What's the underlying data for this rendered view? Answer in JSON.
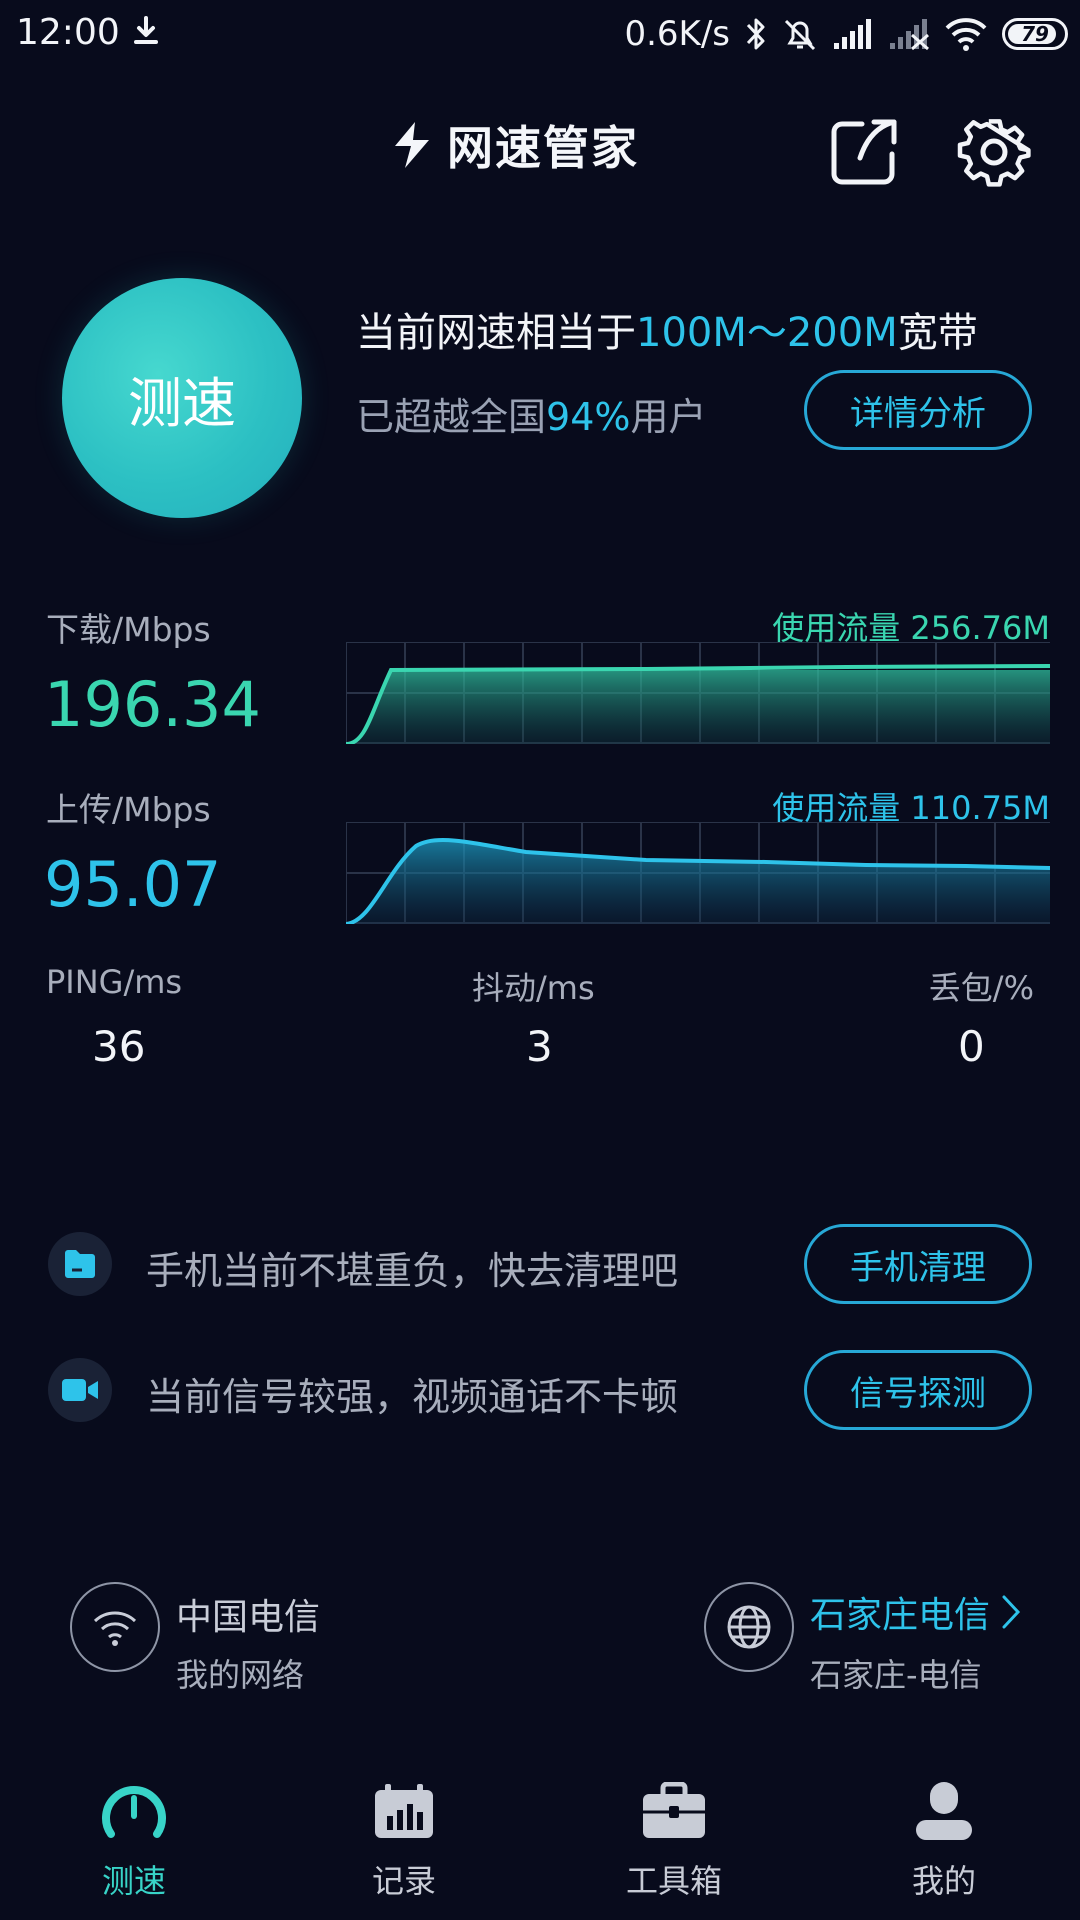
{
  "status_bar": {
    "time": "12:00",
    "net_speed": "0.6K/s",
    "battery": "79"
  },
  "header": {
    "app_title": "网速管家",
    "share_icon": "share-icon",
    "settings_icon": "gear-icon"
  },
  "hero": {
    "test_button": "测速",
    "equiv_prefix": "当前网速相当于",
    "equiv_range": "100M～200M",
    "equiv_suffix": "宽带",
    "beat_prefix": "已超越全国",
    "beat_percent": "94%",
    "beat_suffix": "用户",
    "detail_button": "详情分析"
  },
  "download": {
    "label": "下载/Mbps",
    "value": "196.34",
    "usage": "使用流量 256.76M",
    "color": "#3ad6b0"
  },
  "upload": {
    "label": "上传/Mbps",
    "value": "95.07",
    "usage": "使用流量 110.75M",
    "color": "#2ec3ea"
  },
  "stats": {
    "ping_label": "PING/ms",
    "ping_value": "36",
    "jitter_label": "抖动/ms",
    "jitter_value": "3",
    "loss_label": "丢包/%",
    "loss_value": "0"
  },
  "tips": [
    {
      "icon": "folder-icon",
      "text": "手机当前不堪重负，快去清理吧",
      "button": "手机清理"
    },
    {
      "icon": "video-camera-icon",
      "text": "当前信号较强，视频通话不卡顿",
      "button": "信号探测"
    }
  ],
  "network": {
    "wifi_name": "中国电信",
    "wifi_sub": "我的网络",
    "server_name": "石家庄电信",
    "server_sub": "石家庄-电信"
  },
  "nav": [
    {
      "label": "测速",
      "icon": "speedometer-icon",
      "active": true
    },
    {
      "label": "记录",
      "icon": "calendar-chart-icon",
      "active": false
    },
    {
      "label": "工具箱",
      "icon": "toolbox-icon",
      "active": false
    },
    {
      "label": "我的",
      "icon": "person-icon",
      "active": false
    }
  ],
  "colors": {
    "background": "#080b1c",
    "accent_cyan": "#2ec3ea",
    "accent_green": "#3ad6b0"
  }
}
